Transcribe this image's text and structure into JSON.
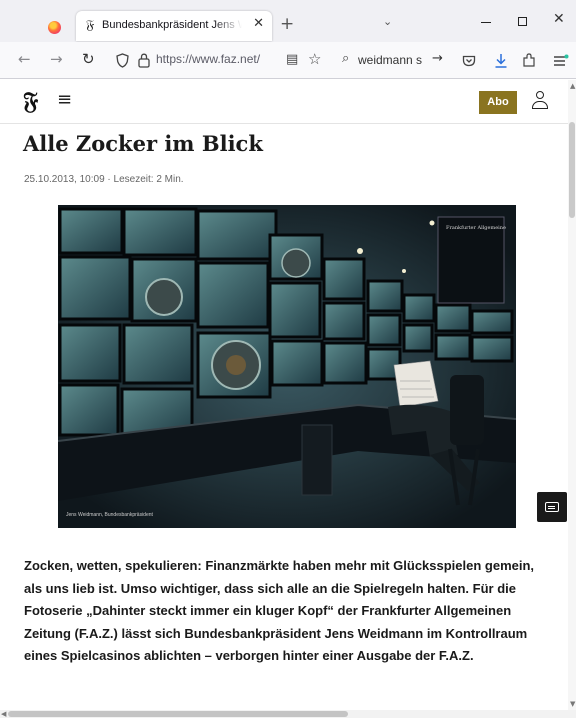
{
  "browser": {
    "tab": {
      "favicon": "𝔉",
      "title": "Bundesbankpräsident Jens Weidmann",
      "close": "✕"
    },
    "new_tab": "+",
    "tab_list": "⌄",
    "window": {
      "close": "✕"
    },
    "nav": {
      "back": "←",
      "forward": "→",
      "reload": "↻"
    },
    "url": "https://www.faz.net/",
    "search": {
      "value": "weidmann s",
      "go": "→"
    },
    "icons": [
      "shield-icon",
      "lock-icon",
      "reader-view-icon",
      "star-icon",
      "search-icon",
      "pocket-icon",
      "download-icon",
      "extensions-icon",
      "app-menu-icon"
    ]
  },
  "site": {
    "logo": "𝔉",
    "menu_icon": "≡",
    "abo_label": "Abo",
    "accent_color": "#8a7420"
  },
  "article": {
    "title": "Alle Zocker im Blick",
    "meta": "25.10.2013, 10:09 · Lesezeit: 2 Min.",
    "image_caption": "Jens Weidmann, Bundesbankpräsident",
    "teaser": "Zocken, wetten, spekulieren: Finanzmärkte haben mehr mit Glücksspielen gemein, als uns lieb ist. Umso wichtiger, dass sich alle an die Spielregeln halten. Für die Fotoserie „Dahinter steckt immer ein kluger Kopf“ der Frankfurter Allgemeinen Zeitung (F.A.Z.) lässt sich Bundesbankpräsident Jens Weidmann im Kontrollraum eines Spielcasinos ablichten – verborgen hinter einer Ausgabe der F.A.Z.",
    "poster_title": "Frankfurter Allgemeine"
  }
}
